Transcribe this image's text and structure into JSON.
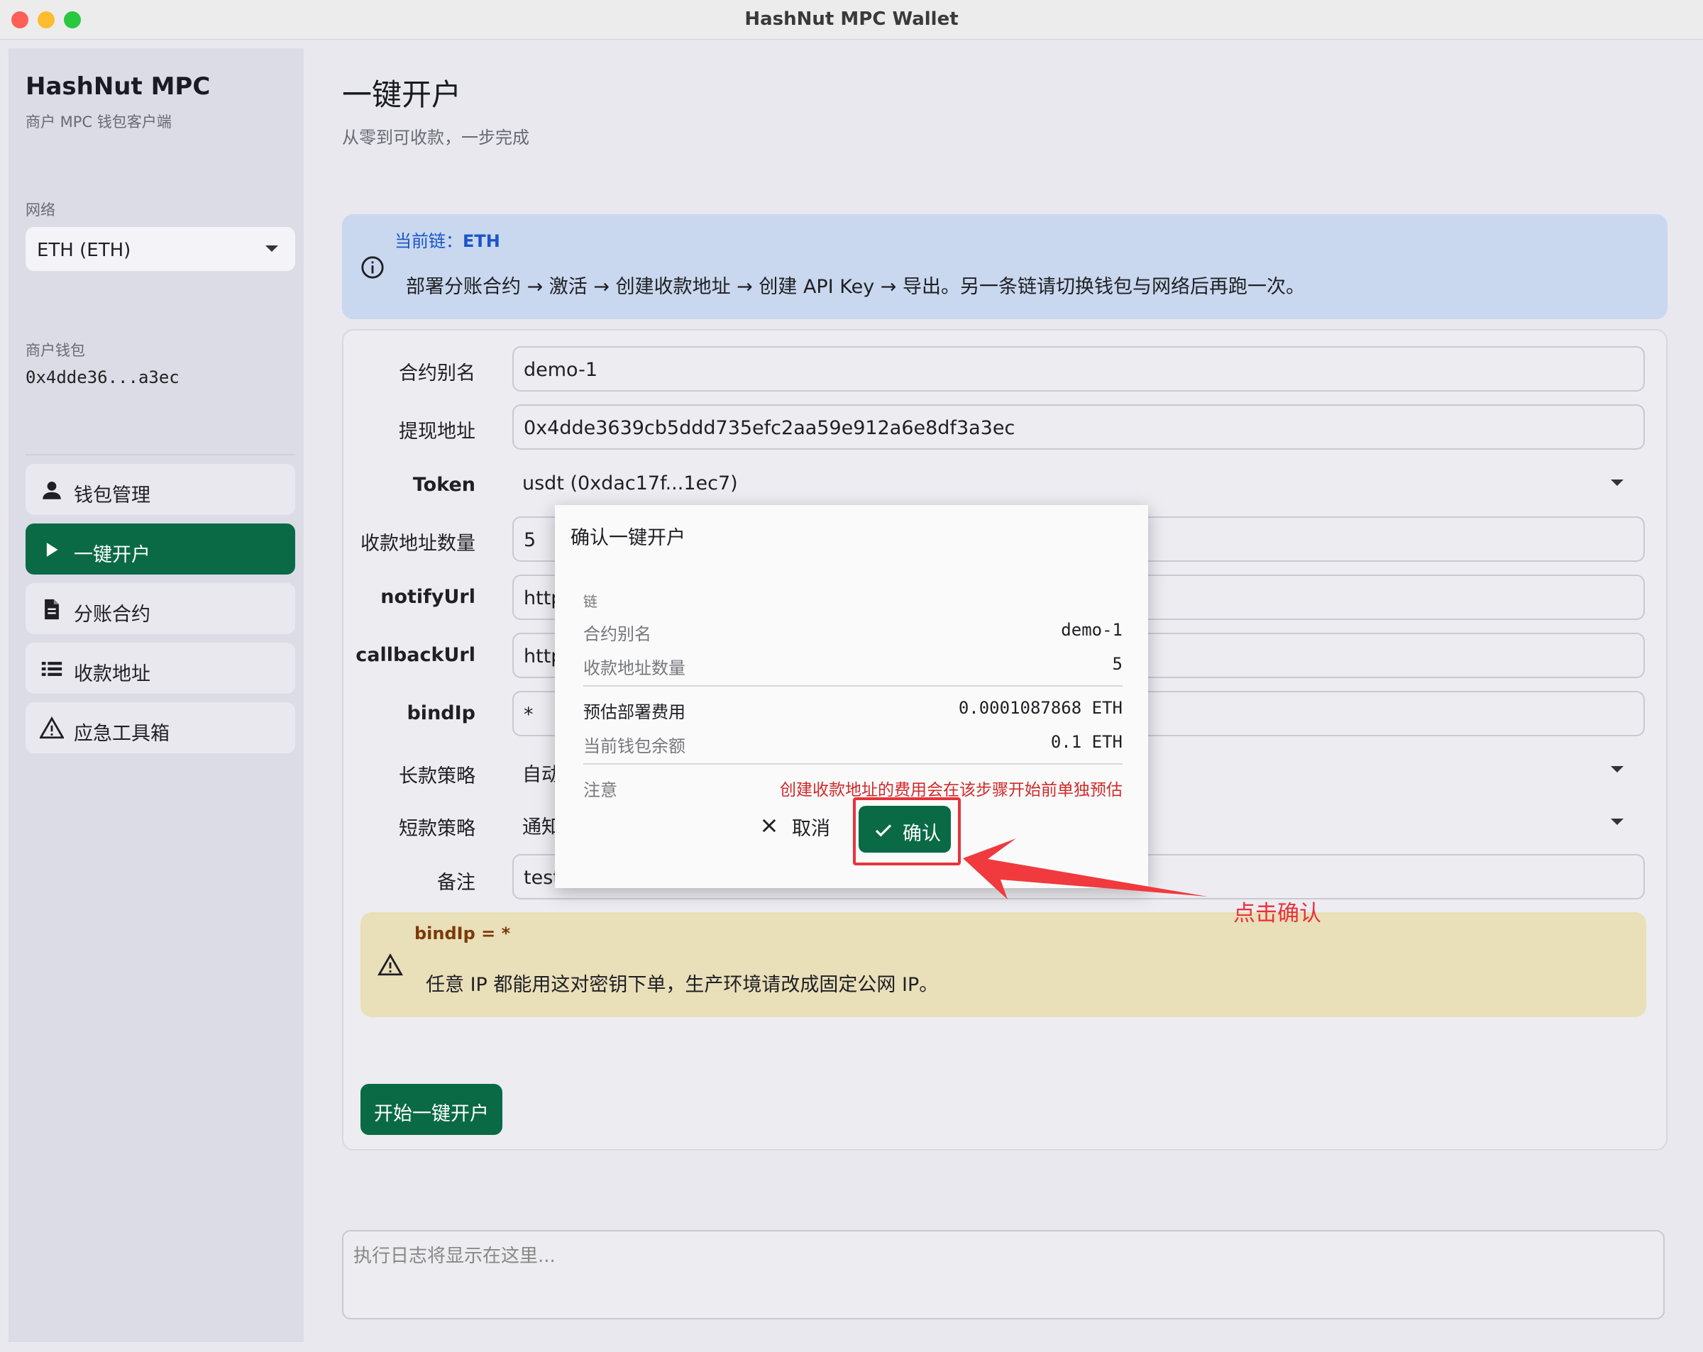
{
  "window": {
    "title": "HashNut MPC Wallet"
  },
  "sidebar": {
    "brand": "HashNut MPC",
    "brand_sub": "商户 MPC 钱包客户端",
    "network_label": "网络",
    "network_value": "ETH (ETH)",
    "wallet_label": "商户钱包",
    "wallet_address": "0x4dde36...a3ec",
    "nav": [
      {
        "label": "钱包管理",
        "icon": "person-icon"
      },
      {
        "label": "一键开户",
        "icon": "play-icon",
        "active": true
      },
      {
        "label": "分账合约",
        "icon": "document-icon"
      },
      {
        "label": "收款地址",
        "icon": "list-icon"
      },
      {
        "label": "应急工具箱",
        "icon": "warning-icon"
      }
    ]
  },
  "main": {
    "title": "一键开户",
    "subtitle": "从零到可收款，一步完成",
    "info": {
      "chain_prefix": "当前链：",
      "chain_value": "ETH",
      "message": "部署分账合约 → 激活 → 创建收款地址 → 创建 API Key → 导出。另一条链请切换钱包与网络后再跑一次。"
    },
    "form": {
      "alias_label": "合约别名",
      "alias_value": "demo-1",
      "withdraw_label": "提现地址",
      "withdraw_value": "0x4dde3639cb5ddd735efc2aa59e912a6e8df3a3ec",
      "token_label": "Token",
      "token_value": "usdt (0xdac17f...1ec7)",
      "count_label": "收款地址数量",
      "count_value": "5",
      "notify_label": "notifyUrl",
      "notify_value": "http",
      "callback_label": "callbackUrl",
      "callback_value": "http",
      "bindip_label": "bindIp",
      "bindip_value": "*",
      "long_label": "长款策略",
      "long_value": "自动",
      "short_label": "短款策略",
      "short_value": "通知",
      "remark_label": "备注",
      "remark_value": "test"
    },
    "warning": {
      "title": "bindIp = *",
      "message": "任意 IP 都能用这对密钥下单，生产环境请改成固定公网 IP。"
    },
    "start_button": "开始一键开户",
    "log_placeholder": "执行日志将显示在这里..."
  },
  "dialog": {
    "title": "确认一键开户",
    "chain_key": "链",
    "alias_key": "合约别名",
    "alias_value": "demo-1",
    "count_key": "收款地址数量",
    "count_value": "5",
    "fee_key": "预估部署费用",
    "fee_value": "0.0001087868 ETH",
    "balance_key": "当前钱包余额",
    "balance_value": "0.1 ETH",
    "note_key": "注意",
    "note_value": "创建收款地址的费用会在该步骤开始前单独预估",
    "cancel": "取消",
    "confirm": "确认"
  },
  "annotation": {
    "hint": "点击确认",
    "color": "#e8333a"
  },
  "colors": {
    "accent": "#0a6a45",
    "info_bg": "#c9d8ee",
    "warn_bg": "#e9dfb9"
  }
}
